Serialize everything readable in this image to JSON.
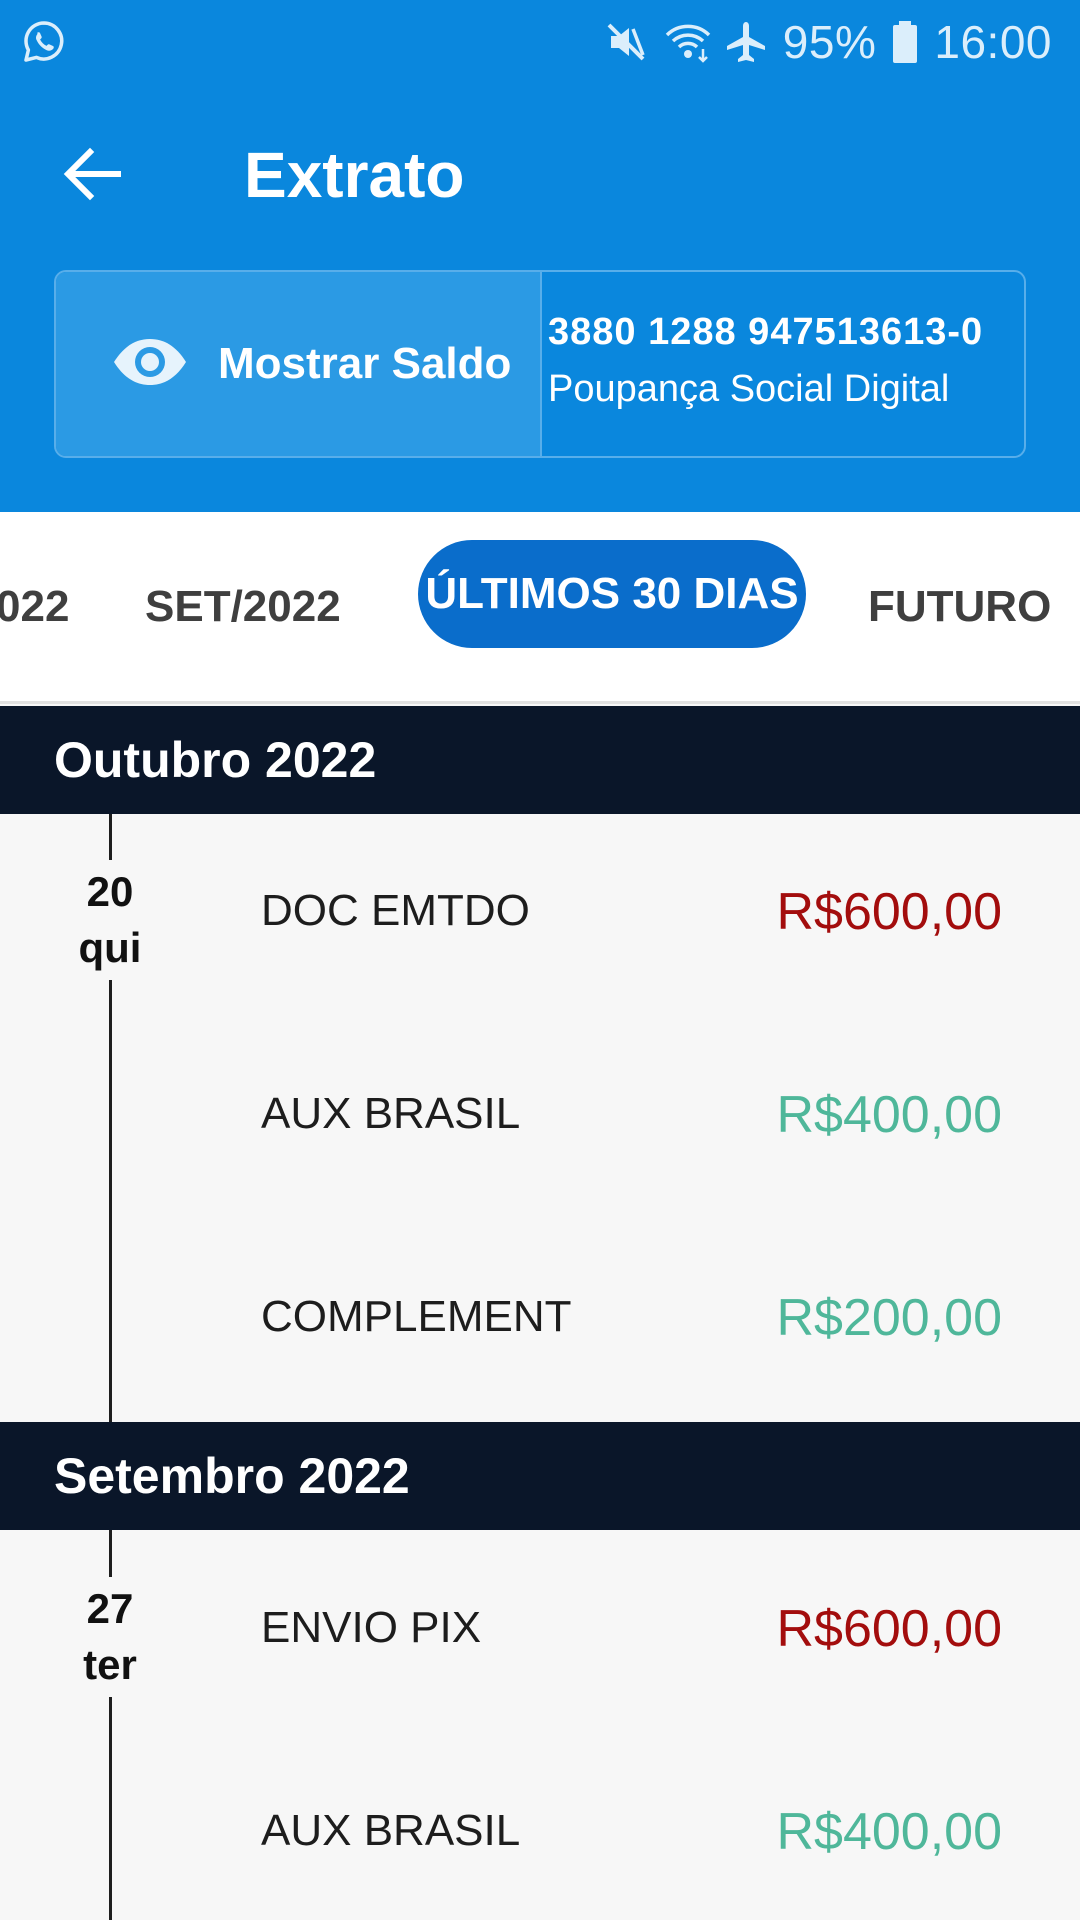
{
  "status_bar": {
    "left_icon": "whatsapp-icon",
    "icons": [
      "mute-icon",
      "wifi-icon",
      "airplane-icon",
      "battery-icon"
    ],
    "battery": "95%",
    "time": "16:00"
  },
  "app_bar": {
    "back_icon": "arrow-left-icon",
    "title": "Extrato"
  },
  "account": {
    "show_balance_icon": "eye-icon",
    "show_balance_label": "Mostrar Saldo",
    "number": "3880 1288 947513613-0",
    "type": "Poupança Social Digital"
  },
  "tabs": [
    {
      "label": "022",
      "active": false
    },
    {
      "label": "SET/2022",
      "active": false
    },
    {
      "label": "ÚLTIMOS 30 DIAS",
      "active": true
    },
    {
      "label": "FUTURO",
      "active": false
    }
  ],
  "months": [
    {
      "title": "Outubro 2022",
      "days": [
        {
          "day": "20",
          "weekday": "qui",
          "transactions": [
            {
              "description": "DOC EMTDO",
              "amount": "R$600,00",
              "kind": "debit"
            },
            {
              "description": "AUX BRASIL",
              "amount": "R$400,00",
              "kind": "credit"
            },
            {
              "description": "COMPLEMENT",
              "amount": "R$200,00",
              "kind": "credit"
            }
          ]
        }
      ]
    },
    {
      "title": "Setembro 2022",
      "days": [
        {
          "day": "27",
          "weekday": "ter",
          "transactions": [
            {
              "description": "ENVIO PIX",
              "amount": "R$600,00",
              "kind": "debit"
            },
            {
              "description": "AUX BRASIL",
              "amount": "R$400,00",
              "kind": "credit"
            }
          ]
        }
      ]
    }
  ],
  "colors": {
    "header_blue": "#0a87dd",
    "active_tab": "#0a6dcb",
    "month_header": "#0a1629",
    "debit": "#a30d0d",
    "credit": "#4fb79a"
  }
}
